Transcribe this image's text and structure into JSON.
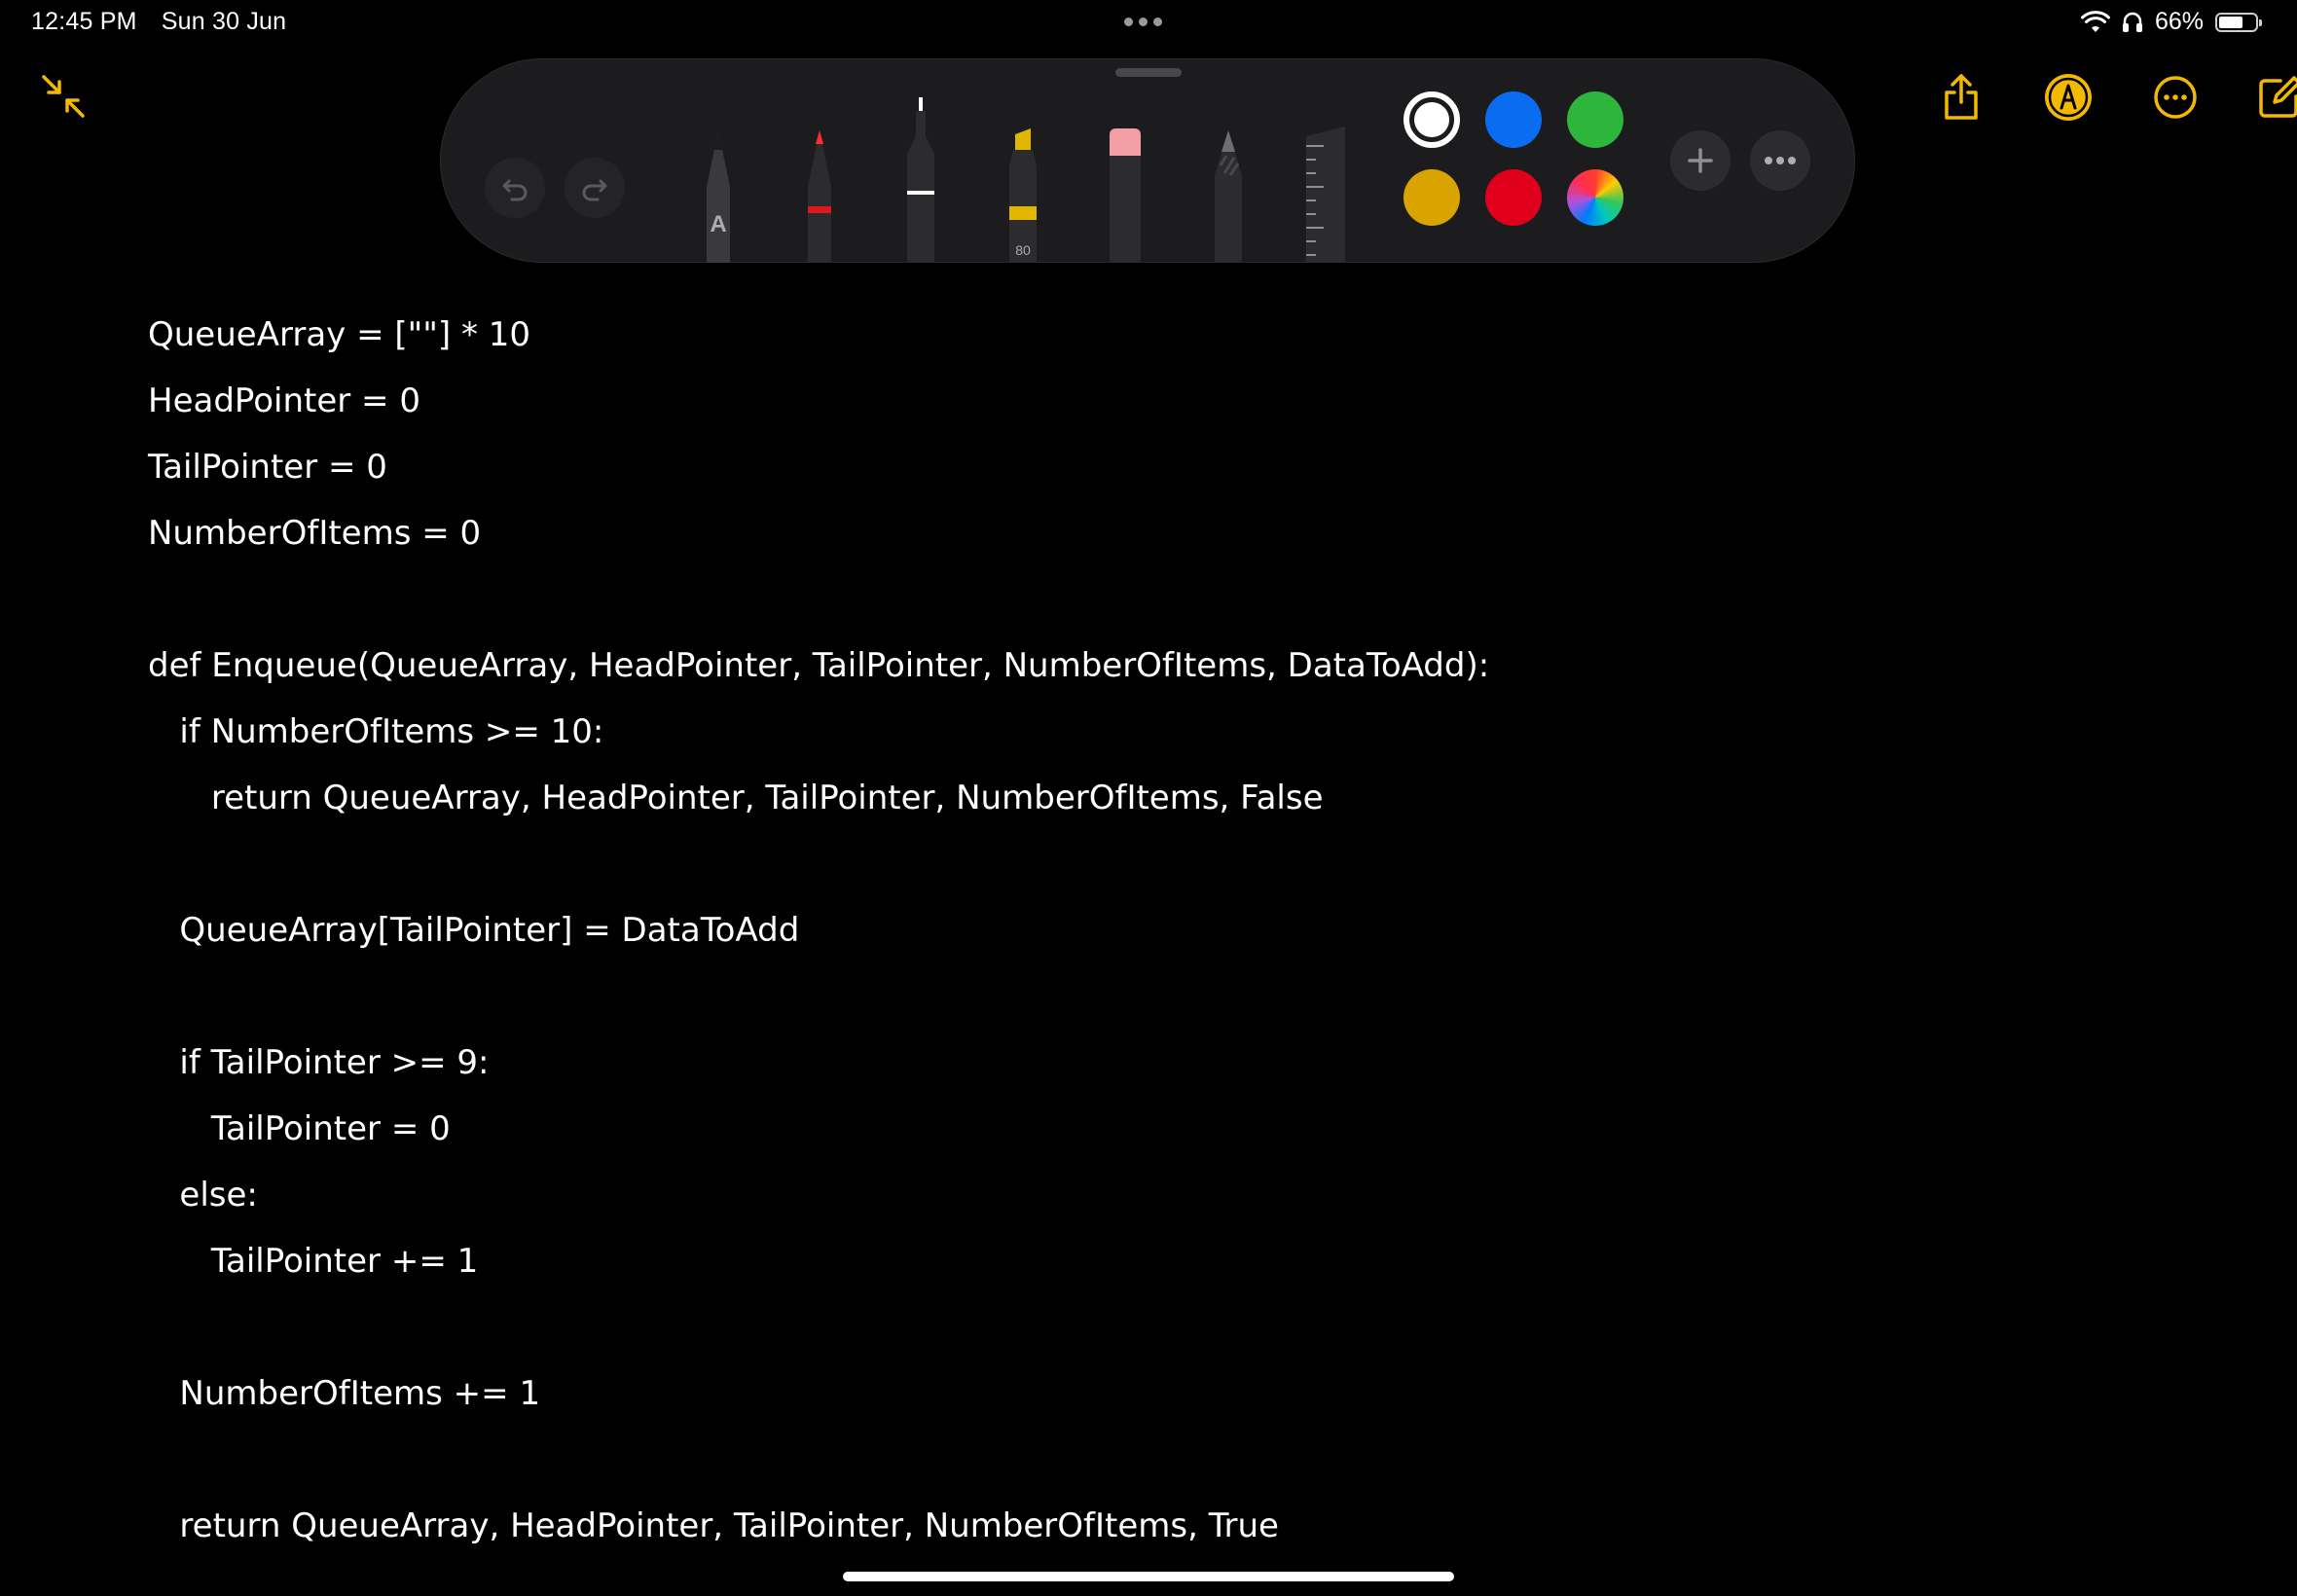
{
  "status_bar": {
    "time": "12:45 PM",
    "date": "Sun 30 Jun",
    "battery_text": "66%",
    "battery_level": 0.66
  },
  "toolbar": {
    "minimize_icon": "arrows-in-icon",
    "share_icon": "share-icon",
    "markup_icon": "markup-pen-icon",
    "more_icon": "ellipsis-circle-icon",
    "compose_icon": "compose-icon",
    "accent_color": "#F2B900"
  },
  "palette": {
    "undo_icon": "undo-icon",
    "redo_icon": "redo-icon",
    "tools": [
      {
        "name": "monoline",
        "label": "A"
      },
      {
        "name": "pen"
      },
      {
        "name": "fineliner"
      },
      {
        "name": "highlighter",
        "label": "80"
      },
      {
        "name": "eraser"
      },
      {
        "name": "pencil"
      },
      {
        "name": "ruler"
      }
    ],
    "colors": [
      "#FFFFFF",
      "#0A6CF0",
      "#2DB53C",
      "#D9A400",
      "#E0001B",
      "multicolor"
    ],
    "selected_color": "#FFFFFF",
    "add_icon": "plus-icon",
    "more_icon": "ellipsis-icon"
  },
  "note": {
    "lines": [
      "QueueArray = [\"\"] * 10",
      "HeadPointer = 0",
      "TailPointer = 0",
      "NumberOfItems = 0",
      "",
      "def Enqueue(QueueArray, HeadPointer, TailPointer, NumberOfItems, DataToAdd):",
      "   if NumberOfItems >= 10:",
      "      return QueueArray, HeadPointer, TailPointer, NumberOfItems, False",
      "",
      "   QueueArray[TailPointer] = DataToAdd",
      "",
      "   if TailPointer >= 9:",
      "      TailPointer = 0",
      "   else:",
      "      TailPointer += 1",
      "",
      "   NumberOfItems += 1",
      "",
      "   return QueueArray, HeadPointer, TailPointer, NumberOfItems, True"
    ]
  }
}
